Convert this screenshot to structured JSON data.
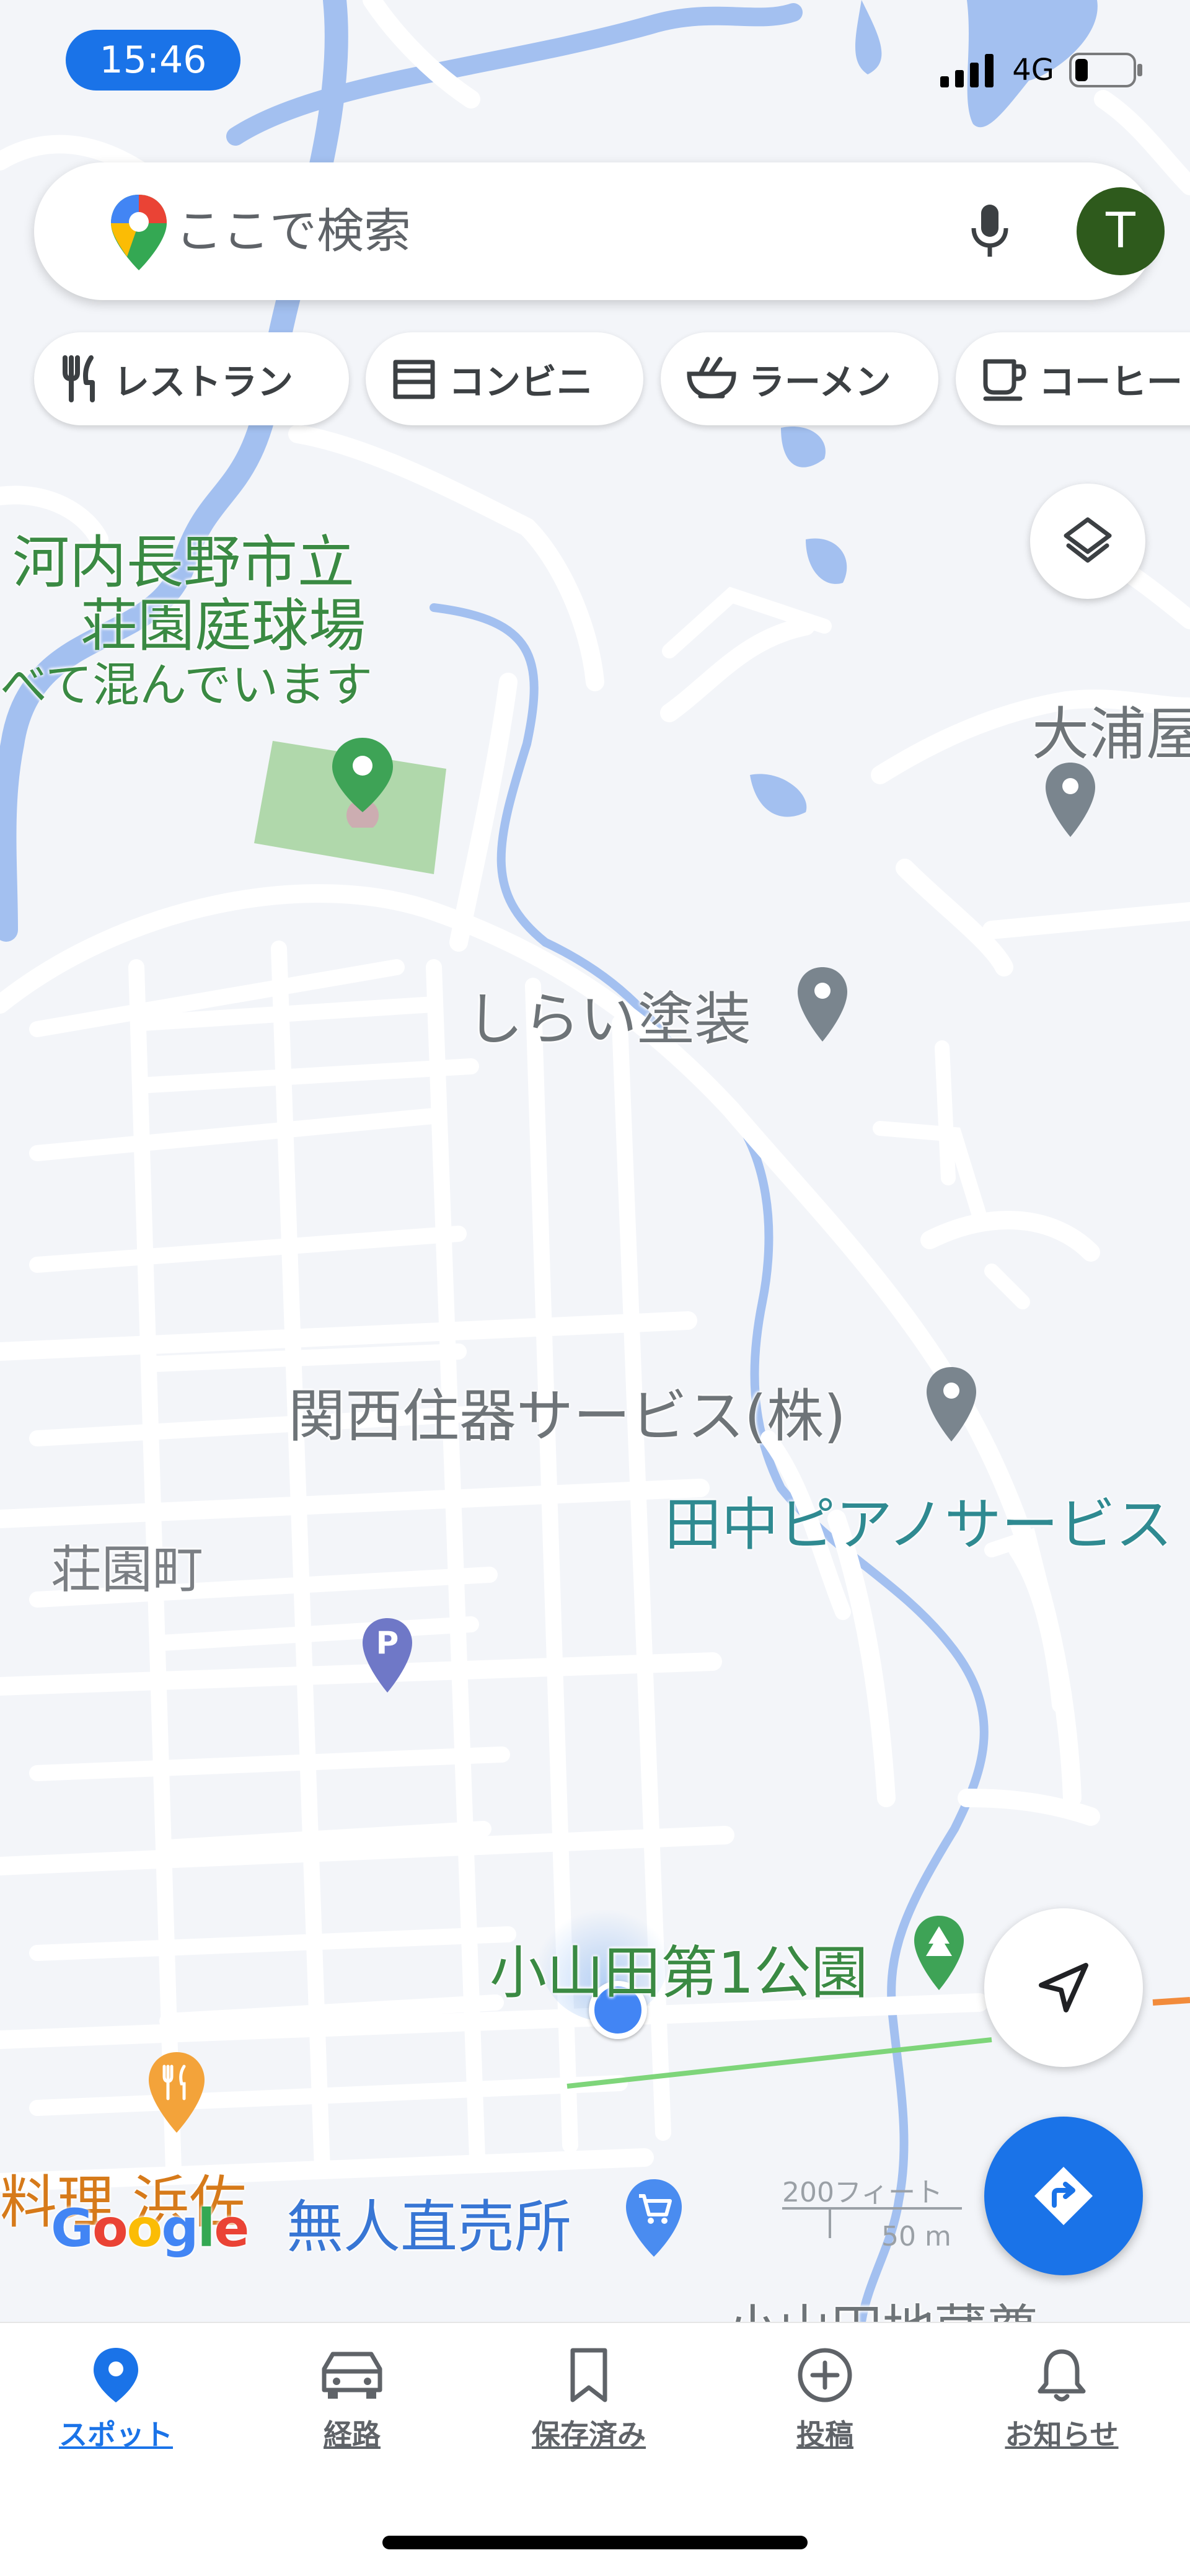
{
  "status": {
    "time": "15:46",
    "network": "4G"
  },
  "search": {
    "placeholder": "ここで検索",
    "avatar_initial": "T"
  },
  "chips": [
    {
      "label": "レストラン",
      "icon": "fork-knife-icon"
    },
    {
      "label": "コンビニ",
      "icon": "store-icon"
    },
    {
      "label": "ラーメン",
      "icon": "ramen-icon"
    },
    {
      "label": "コーヒー",
      "icon": "coffee-icon"
    }
  ],
  "map_labels": {
    "tennis_line1": "河内長野市立",
    "tennis_line2": "荘園庭球場",
    "tennis_busy": "べて混んでいます",
    "ourase": "大浦屋",
    "shirai": "しらい塗装",
    "kansai": "関西住器サービス(株)",
    "tanaka": "田中ピアノサービス",
    "shoen": "荘園町",
    "park": "小山田第1公園",
    "hamasa": "料理 浜佐",
    "mujin": "無人直売所",
    "jizo": "小山田地蔵尊",
    "parking": "P"
  },
  "scale": {
    "feet": "200フィート",
    "meters": "50 m"
  },
  "logo": "Google",
  "bottom_nav": [
    {
      "label": "スポット",
      "icon": "pin-icon",
      "active": true
    },
    {
      "label": "経路",
      "icon": "car-icon",
      "active": false
    },
    {
      "label": "保存済み",
      "icon": "bookmark-icon",
      "active": false
    },
    {
      "label": "投稿",
      "icon": "plus-circle-icon",
      "active": false
    },
    {
      "label": "お知らせ",
      "icon": "bell-icon",
      "active": false
    }
  ],
  "colors": {
    "accent": "#1a73e8",
    "map_bg": "#f3f5f9",
    "road": "#ffffff",
    "river": "#a3c0f0",
    "park_pin": "#3ea356",
    "avatar": "#2e5a1c"
  }
}
